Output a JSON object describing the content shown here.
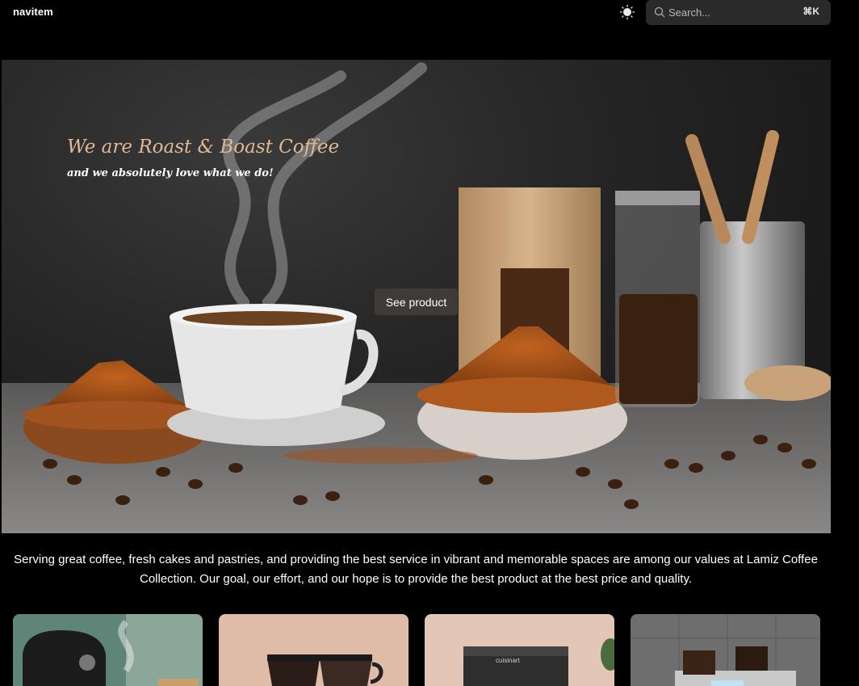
{
  "header": {
    "brand": "navitem",
    "search": {
      "placeholder": "Search...",
      "shortcut": "⌘K"
    },
    "theme_icon": "sun-icon"
  },
  "hero": {
    "title": "We are Roast & Boast Coffee",
    "subtitle": "and we absolutely love what we do!",
    "cta_label": "See product"
  },
  "intro": {
    "text": "Serving great coffee, fresh cakes and pastries, and providing the best service in vibrant and memorable spaces are among our values at Lamiz Coffee Collection. Our goal, our effort, and our hope is to provide the best product at the best price and quality."
  },
  "products": [
    {
      "name": "espresso-machine-product"
    },
    {
      "name": "pour-over-product"
    },
    {
      "name": "drip-brewer-product"
    },
    {
      "name": "grinder-machine-product"
    }
  ],
  "colors": {
    "accent_title": "#e0b994",
    "button_bg": "#3f3b38",
    "search_bg": "#2a2a2a"
  }
}
